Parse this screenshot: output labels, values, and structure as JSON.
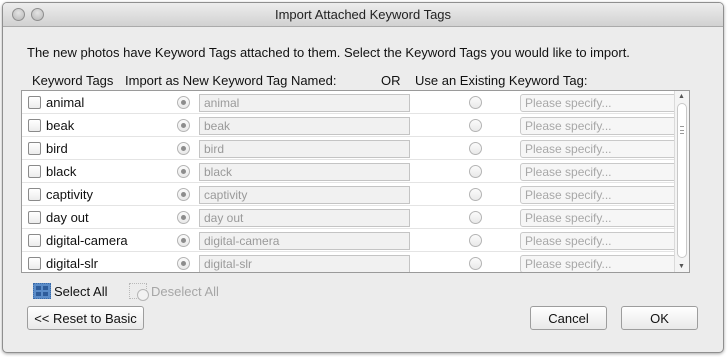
{
  "window": {
    "title": "Import Attached Keyword Tags"
  },
  "intro": "The new photos have Keyword Tags attached to them.  Select the Keyword Tags you would like to import.",
  "headers": {
    "keyword_tags": "Keyword Tags",
    "import_as_new": "Import as New Keyword Tag Named:",
    "or": "OR",
    "use_existing": "Use an Existing Keyword Tag:"
  },
  "rows": [
    {
      "keyword": "animal",
      "new_name": "animal",
      "existing": "Please specify..."
    },
    {
      "keyword": "beak",
      "new_name": "beak",
      "existing": "Please specify..."
    },
    {
      "keyword": "bird",
      "new_name": "bird",
      "existing": "Please specify..."
    },
    {
      "keyword": "black",
      "new_name": "black",
      "existing": "Please specify..."
    },
    {
      "keyword": "captivity",
      "new_name": "captivity",
      "existing": "Please specify..."
    },
    {
      "keyword": "day out",
      "new_name": "day out",
      "existing": "Please specify..."
    },
    {
      "keyword": "digital-camera",
      "new_name": "digital-camera",
      "existing": "Please specify..."
    },
    {
      "keyword": "digital-slr",
      "new_name": "digital-slr",
      "existing": "Please specify..."
    }
  ],
  "actions": {
    "select_all": "Select All",
    "deselect_all": "Deselect All"
  },
  "buttons": {
    "reset": "<< Reset to Basic",
    "cancel": "Cancel",
    "ok": "OK"
  },
  "icons": {
    "select_all": "select-all-icon",
    "deselect_all": "deselect-all-icon",
    "dropdown": "chevron-down-icon"
  }
}
